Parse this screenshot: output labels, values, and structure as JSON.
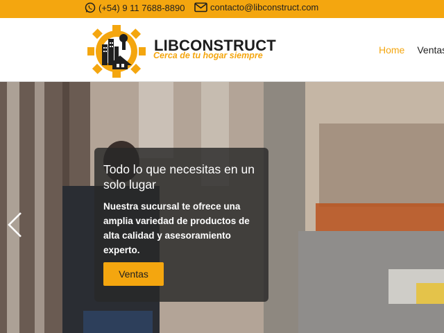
{
  "topbar": {
    "phone": "(+54) 9 11 7688-8890",
    "email": "contacto@libconstruct.com",
    "phone_icon": "whatsapp-icon",
    "email_icon": "envelope-icon",
    "background": "#f4a60f"
  },
  "brand": {
    "name": "LIBCONSTRUCT",
    "tagline": "Cerca de tu hogar siempre",
    "accent": "#f4a60f"
  },
  "nav": {
    "items": [
      {
        "label": "Home",
        "active": true
      },
      {
        "label": "Ventas",
        "active": false
      }
    ]
  },
  "hero": {
    "title": "Todo lo que necesitas en un solo lugar",
    "text": "Nuestra sucursal te ofrece una amplia variedad de productos de alta calidad y asesoramiento experto.",
    "button_label": "Ventas",
    "prev_icon": "chevron-left-icon"
  }
}
